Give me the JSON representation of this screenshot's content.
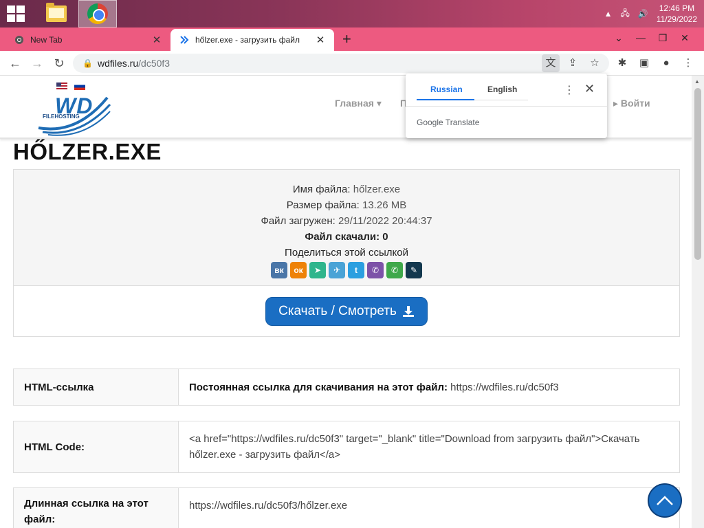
{
  "taskbar": {
    "time": "12:46 PM",
    "date": "11/29/2022"
  },
  "browser": {
    "tabs": [
      {
        "label": "New Tab",
        "active": false
      },
      {
        "label": "hőlzer.exe - загрузить файл",
        "active": true
      }
    ],
    "url_host": "wdfiles.ru",
    "url_path": "/dc50f3"
  },
  "translate_popup": {
    "lang_from": "Russian",
    "lang_to": "English",
    "brand": "Google Translate"
  },
  "site": {
    "logo_text": "WD",
    "logo_sub": "FILEHOSTING",
    "nav": {
      "home": "Главная ▾",
      "partial": "П",
      "login": "Войти"
    }
  },
  "file": {
    "title": "HŐLZER.EXE",
    "name_label": "Имя файла:",
    "name_value": "hőlzer.exe",
    "size_label": "Размер файла:",
    "size_value": "13.26 MB",
    "uploaded_label": "Файл загружен:",
    "uploaded_value": "29/11/2022 20:44:37",
    "downloads_text": "Файл скачали: 0",
    "share_text": "Поделиться этой ссылкой",
    "download_button": "Скачать / Смотреть"
  },
  "links": {
    "html_link_label": "HTML-ссылка",
    "html_link_prefix": "Постоянная ссылка для скачивания на этот файл:",
    "html_link_value": "https://wdfiles.ru/dc50f3",
    "html_code_label": "HTML Code:",
    "html_code_value": "<a href=\"https://wdfiles.ru/dc50f3\" target=\"_blank\" title=\"Download from загрузить файл\">Скачать hőlzer.exe - загрузить файл</a>",
    "long_link_label": "Длинная ссылка на этот файл:",
    "long_link_value": "https://wdfiles.ru/dc50f3/hőlzer.exe"
  },
  "share_icons": [
    {
      "name": "vk-icon",
      "glyph": "вк",
      "color": "#4a76a8"
    },
    {
      "name": "odnoklassniki-icon",
      "glyph": "ок",
      "color": "#ee8208"
    },
    {
      "name": "sms-icon",
      "glyph": "➤",
      "color": "#2fb58c"
    },
    {
      "name": "telegram-icon",
      "glyph": "✈",
      "color": "#4aa3d6"
    },
    {
      "name": "twitter-icon",
      "glyph": "t",
      "color": "#2b9fe0"
    },
    {
      "name": "viber-icon",
      "glyph": "✆",
      "color": "#7d52a8"
    },
    {
      "name": "whatsapp-icon",
      "glyph": "✆",
      "color": "#3fa84a"
    },
    {
      "name": "livejournal-icon",
      "glyph": "✎",
      "color": "#13384e"
    }
  ],
  "colors": {
    "accent": "#1a6ec3",
    "tabstrip": "#ed5a80"
  }
}
